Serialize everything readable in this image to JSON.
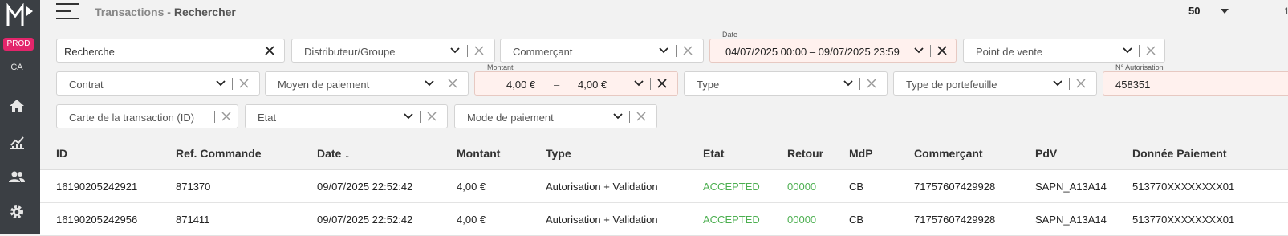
{
  "sidebar": {
    "env_badge": "PROD",
    "user_initials": "CA"
  },
  "header": {
    "section": "Transactions",
    "separator": " - ",
    "page": "Rechercher",
    "page_size": "50",
    "page_number": "1"
  },
  "filters": {
    "recherche": "Recherche",
    "distributeur": "Distributeur/Groupe",
    "commercant": "Commerçant",
    "date_label": "Date",
    "date_value": "04/07/2025  00:00  –  09/07/2025  23:59",
    "point_de_vente": "Point de vente",
    "contrat": "Contrat",
    "moyen_paiement": "Moyen de paiement",
    "montant_label": "Montant",
    "montant_min": "4,00 €",
    "montant_dash": "–",
    "montant_max": "4,00 €",
    "type": "Type",
    "type_portefeuille": "Type de portefeuille",
    "autorisation_label": "N° Autorisation",
    "autorisation_value": "458351",
    "carte": "Carte de la transaction (ID)",
    "etat": "Etat",
    "mode_paiement": "Mode de paiement"
  },
  "table": {
    "columns": [
      "ID",
      "Ref. Commande",
      "Date ↓",
      "Montant",
      "Type",
      "Etat",
      "Retour",
      "MdP",
      "Commerçant",
      "PdV",
      "Donnée Paiement"
    ],
    "rows": [
      [
        "16190205242921",
        "871370",
        "09/07/2025 22:52:42",
        "4,00 €",
        "Autorisation + Validation",
        "ACCEPTED",
        "00000",
        "CB",
        "71757607429928",
        "SAPN_A13A14",
        "513770XXXXXXXX01"
      ],
      [
        "16190205242956",
        "871411",
        "09/07/2025 22:52:42",
        "4,00 €",
        "Autorisation + Validation",
        "ACCEPTED",
        "00000",
        "CB",
        "71757607429928",
        "SAPN_A13A14",
        "513770XXXXXXXX01"
      ]
    ]
  },
  "colors": {
    "sidebar": "#3b3f44",
    "accent": "#e3256b",
    "success": "#4caf50"
  },
  "icons": [
    "menu-icon",
    "home-icon",
    "chart-icon",
    "users-icon",
    "gear-icon",
    "chevron-down-icon",
    "close-icon"
  ]
}
